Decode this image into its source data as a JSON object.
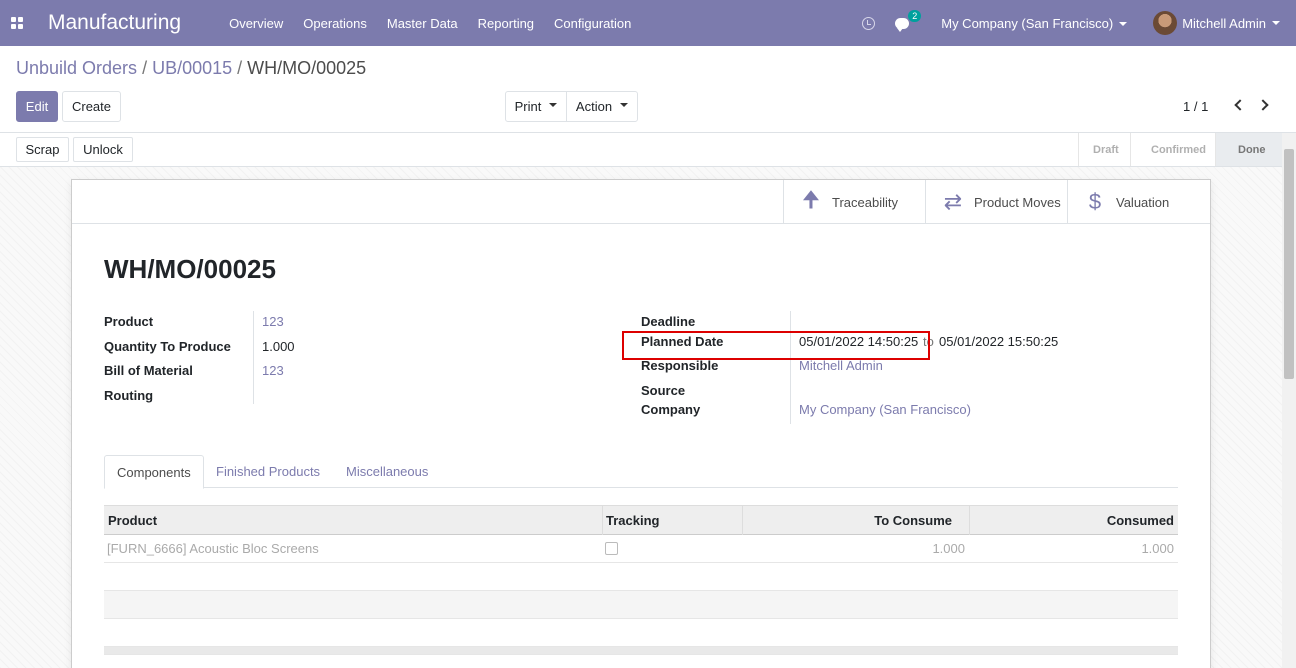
{
  "navbar": {
    "app_title": "Manufacturing",
    "menu": [
      "Overview",
      "Operations",
      "Master Data",
      "Reporting",
      "Configuration"
    ],
    "chat_count": "2",
    "company": "My Company (San Francisco)",
    "user": "Mitchell Admin"
  },
  "breadcrumb": {
    "items": [
      "Unbuild Orders",
      "UB/00015"
    ],
    "current": "WH/MO/00025"
  },
  "toolbar": {
    "edit_label": "Edit",
    "create_label": "Create",
    "print_label": "Print",
    "action_label": "Action",
    "pager": "1 / 1"
  },
  "statusbar": {
    "scrap_label": "Scrap",
    "unlock_label": "Unlock",
    "stages": [
      "Draft",
      "Confirmed",
      "Done"
    ],
    "current_stage": "Done"
  },
  "smart_buttons": {
    "traceability": "Traceability",
    "product_moves": "Product Moves",
    "valuation": "Valuation"
  },
  "form": {
    "title": "WH/MO/00025",
    "product_label": "Product",
    "product_value": "123",
    "qty_label": "Quantity To Produce",
    "qty_value": "1.000",
    "bom_label": "Bill of Material",
    "bom_value": "123",
    "routing_label": "Routing",
    "routing_value": "",
    "deadline_label": "Deadline",
    "deadline_value": "",
    "planned_label": "Planned Date",
    "planned_start": "05/01/2022 14:50:25",
    "planned_to": "to",
    "planned_end": "05/01/2022 15:50:25",
    "responsible_label": "Responsible",
    "responsible_value": "Mitchell Admin",
    "source_label": "Source",
    "source_value": "",
    "company_label": "Company",
    "company_value": "My Company (San Francisco)"
  },
  "tabs": [
    "Components",
    "Finished Products",
    "Miscellaneous"
  ],
  "components_table": {
    "headers": [
      "Product",
      "Tracking",
      "To Consume",
      "Consumed"
    ],
    "rows": [
      {
        "product": "[FURN_6666] Acoustic Bloc Screens",
        "tracking": false,
        "to_consume": "1.000",
        "consumed": "1.000"
      }
    ]
  },
  "colors": {
    "brand": "#7c7bad",
    "highlight": "#dd0000"
  }
}
